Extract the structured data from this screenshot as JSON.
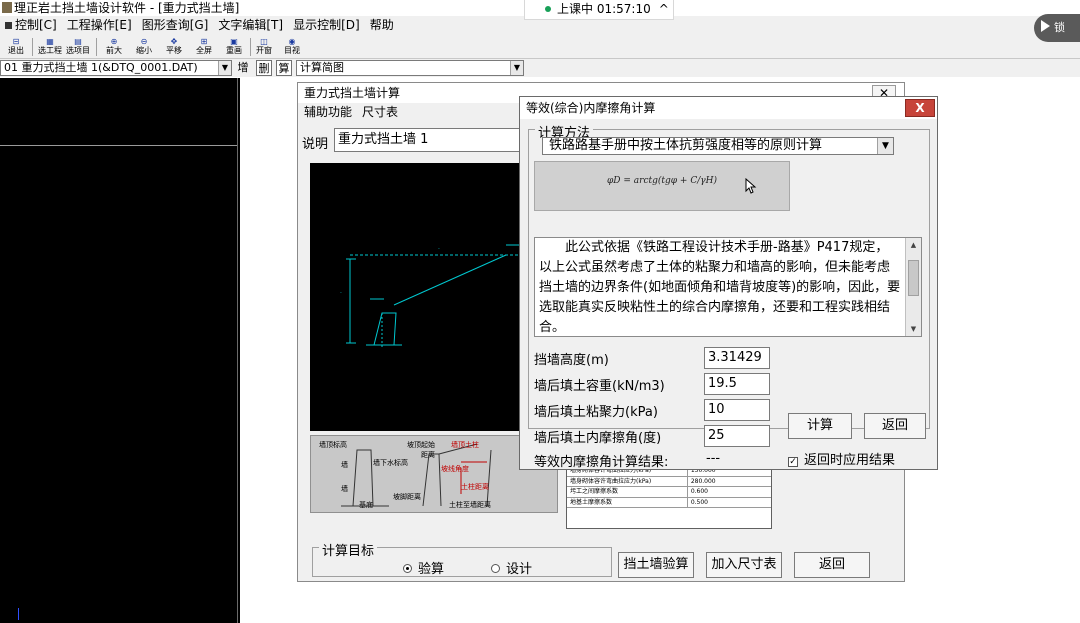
{
  "app": {
    "title": "理正岩土挡土墙设计软件 - [重力式挡土墙]",
    "menu": [
      "控制[C]",
      "工程操作[E]",
      "图形查询[G]",
      "文字编辑[T]",
      "显示控制[D]",
      "帮助"
    ],
    "toolbar": [
      "退出",
      "选工程",
      "选项目",
      "前大",
      "缩小",
      "平移",
      "全屏",
      "重画",
      "开窗",
      "目视"
    ],
    "file_select": "01  重力式挡土墙 1(&DTQ_0001.DAT)",
    "file_buttons": [
      "增",
      "删",
      "算"
    ],
    "view_select": "计算简图"
  },
  "live": {
    "status": "上课中 01:57:10",
    "chevron": "^",
    "video_label": "锁"
  },
  "main_dialog": {
    "title": "重力式挡土墙计算",
    "close": "✕",
    "menu": [
      "辅助功能",
      "尺寸表"
    ],
    "desc_label": "说明",
    "desc_value": "重力式挡土墙 1",
    "legend_labels": [
      "墙顶标高",
      "墙",
      "墙",
      "基底",
      "墙下水标高",
      "坡顶起始",
      "距离",
      "墙顶土柱",
      "坡线角度",
      "坡脚距离",
      "土柱距离",
      "土柱至墙距离"
    ],
    "params": [
      {
        "name": "墙身砌体容许弯曲拉应力(kPa)",
        "value": "150.000"
      },
      {
        "name": "墙身砌体容许弯曲拉应力(kPa)",
        "value": "280.000"
      },
      {
        "name": "圬工之间摩擦系数",
        "value": "0.600"
      },
      {
        "name": "地基土摩擦系数",
        "value": "0.500"
      }
    ],
    "target_legend": "计算目标",
    "target_options": [
      "验算",
      "设计"
    ],
    "target_selected": "验算",
    "btn_check": "挡土墙验算",
    "btn_add": "加入尺寸表",
    "btn_back": "返回"
  },
  "friction_dialog": {
    "title": "等效(综合)内摩擦角计算",
    "close": "X",
    "method_legend": "计算方法",
    "method_selected": "铁路路基手册中按土体抗剪强度相等的原则计算",
    "formula": "φD = arctg(tgφ + C/γH)",
    "description": "此公式依据《铁路工程设计技术手册-路基》P417规定，以上公式虽然考虑了土体的粘聚力和墙高的影响，但未能考虑挡土墙的边界条件(如地面倾角和墙背坡度等)的影响，因此，要选取能真实反映粘性土的综合内摩擦角，还要和工程实践相结合。",
    "fields": [
      {
        "label": "挡墙高度(m)",
        "value": "3.31429"
      },
      {
        "label": "墙后填土容重(kN/m3)",
        "value": "19.5"
      },
      {
        "label": "墙后填土粘聚力(kPa)",
        "value": "10"
      },
      {
        "label": "墙后填土内摩擦角(度)",
        "value": "25"
      }
    ],
    "result_label": "等效内摩擦角计算结果:",
    "result_value": "---",
    "btn_calc": "计算",
    "btn_back": "返回",
    "apply_check_mark": "✓",
    "apply_label": "返回时应用结果"
  },
  "colors": {
    "cad_bg": "#000000",
    "cad_line": "#00c8d0",
    "close_red": "#c7443a"
  }
}
